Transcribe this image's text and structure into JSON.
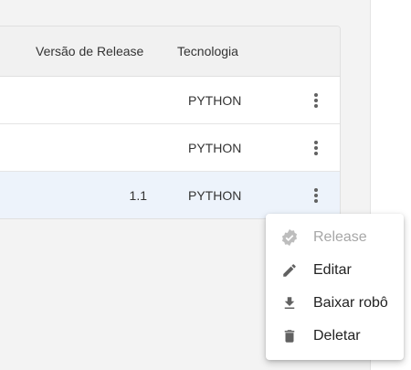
{
  "table": {
    "columns": {
      "version": "Versão de Release",
      "technology": "Tecnologia"
    },
    "rows": [
      {
        "version": "",
        "technology": "PYTHON"
      },
      {
        "version": "",
        "technology": "PYTHON"
      },
      {
        "version": "1.1",
        "technology": "PYTHON"
      }
    ]
  },
  "menu": {
    "items": [
      {
        "label": "Release",
        "icon": "check-seal-icon",
        "disabled": true
      },
      {
        "label": "Editar",
        "icon": "pencil-icon",
        "disabled": false
      },
      {
        "label": "Baixar robô",
        "icon": "download-icon",
        "disabled": false
      },
      {
        "label": "Deletar",
        "icon": "trash-icon",
        "disabled": false
      }
    ]
  },
  "colors": {
    "selected_row": "#edf3fb",
    "header_bg": "#f1f1f1",
    "disabled_text": "#a7a7a7"
  }
}
